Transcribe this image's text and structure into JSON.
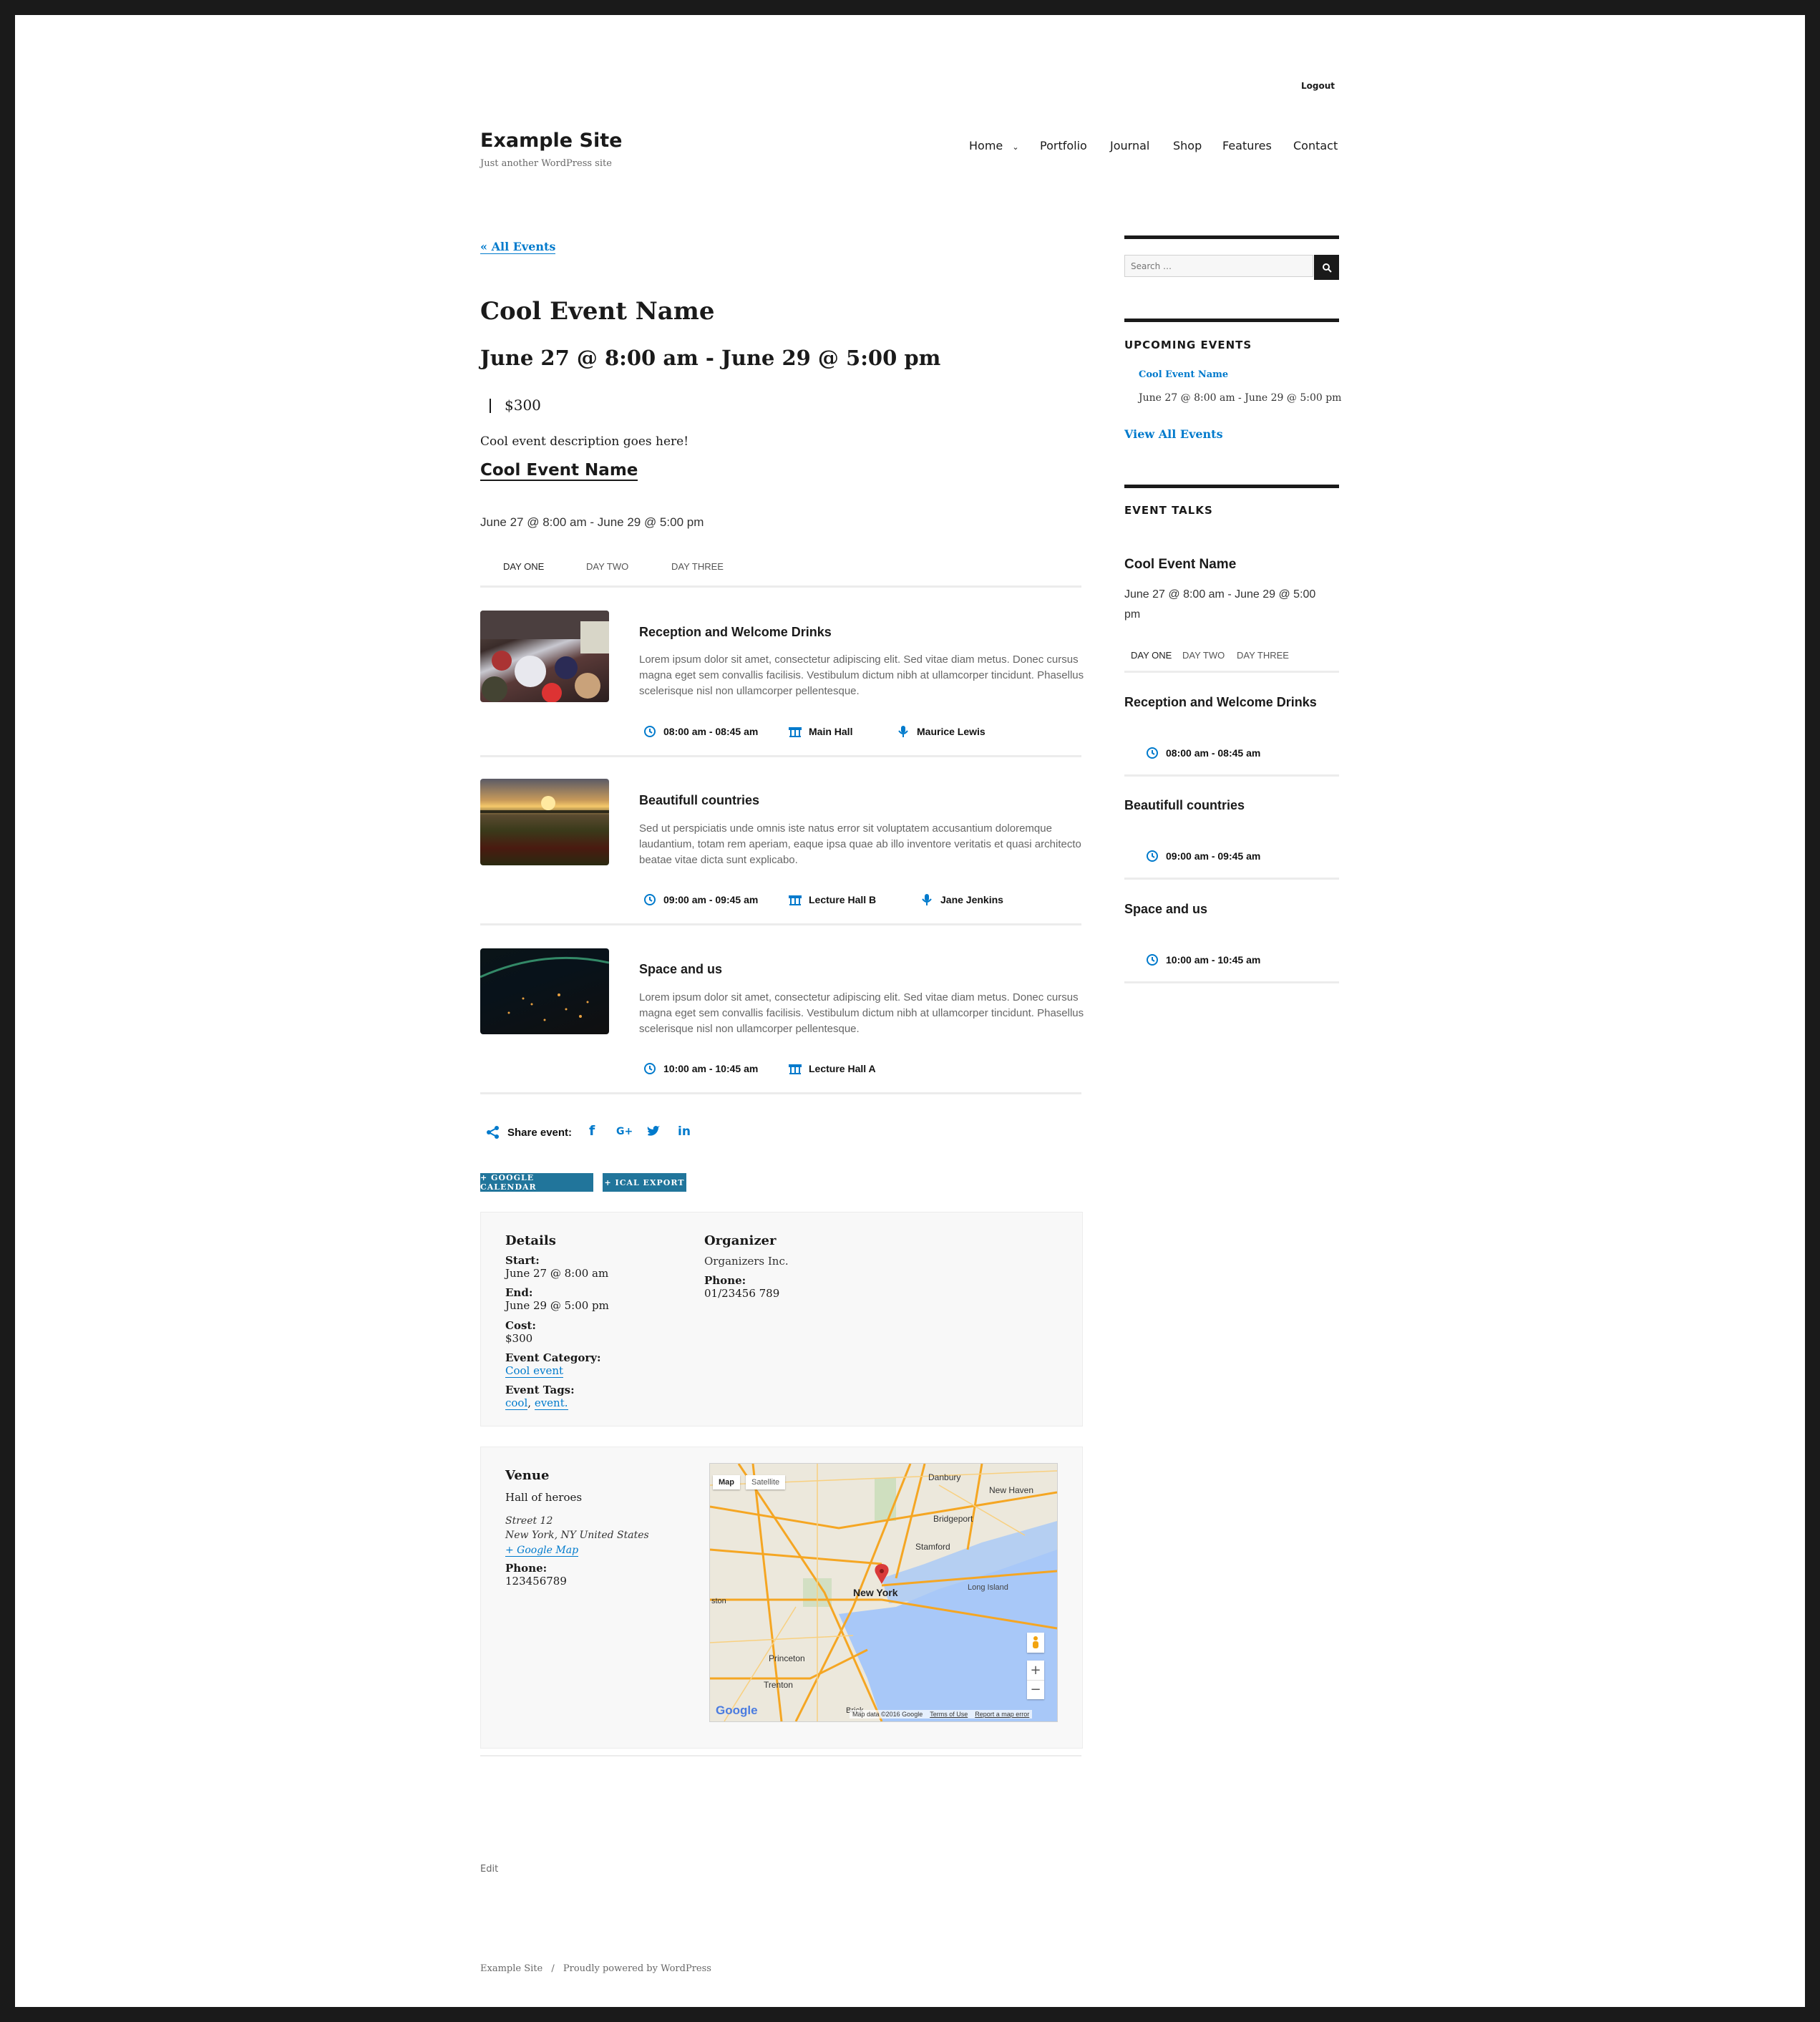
{
  "header": {
    "logout": "Logout",
    "site_title": "Example Site",
    "tagline": "Just another WordPress site",
    "nav": [
      "Home",
      "Portfolio",
      "Journal",
      "Shop",
      "Features",
      "Contact"
    ]
  },
  "main": {
    "back_link": "« All Events",
    "event_title": "Cool Event Name",
    "event_datetime": "June 27 @ 8:00 am - June 29 @ 5:00 pm",
    "cost": "$300",
    "description": "Cool event description goes here!",
    "talks_block": {
      "title": "Cool Event Name",
      "datetime": "June 27 @ 8:00 am - June 29 @ 5:00 pm",
      "tabs": [
        "DAY ONE",
        "DAY TWO",
        "DAY THREE"
      ],
      "talks": [
        {
          "title": "Reception and Welcome Drinks",
          "text": "Lorem ipsum dolor sit amet, consectetur adipiscing elit. Sed vitae diam metus. Donec cursus magna eget sem convallis facilisis. Vestibulum dictum nibh at ullamcorper tincidunt. Phasellus scelerisque nisl non ullamcorper pellentesque.",
          "time": "08:00 am - 08:45 am",
          "location": "Main Hall",
          "speaker": "Maurice Lewis"
        },
        {
          "title": "Beautifull countries",
          "text": "Sed ut perspiciatis unde omnis iste natus error sit voluptatem accusantium doloremque laudantium, totam rem aperiam, eaque ipsa quae ab illo inventore veritatis et quasi architecto beatae vitae dicta sunt explicabo.",
          "time": "09:00 am - 09:45 am",
          "location": "Lecture Hall B",
          "speaker": "Jane Jenkins"
        },
        {
          "title": "Space and us",
          "text": "Lorem ipsum dolor sit amet, consectetur adipiscing elit. Sed vitae diam metus. Donec cursus magna eget sem convallis facilisis. Vestibulum dictum nibh at ullamcorper tincidunt. Phasellus scelerisque nisl non ullamcorper pellentesque.",
          "time": "10:00 am - 10:45 am",
          "location": "Lecture Hall A",
          "speaker": ""
        }
      ]
    },
    "share_label": "Share event:",
    "buttons": {
      "google_calendar": "+ GOOGLE CALENDAR",
      "ical_export": "+ ICAL EXPORT"
    },
    "details": {
      "heading": "Details",
      "start_label": "Start:",
      "start_value": "June 27 @ 8:00 am",
      "end_label": "End:",
      "end_value": "June 29 @ 5:00 pm",
      "cost_label": "Cost:",
      "cost_value": "$300",
      "category_label": "Event Category:",
      "category_value": "Cool event",
      "tags_label": "Event Tags:",
      "tag1": "cool",
      "tag2": "event."
    },
    "organizer": {
      "heading": "Organizer",
      "name": "Organizers Inc.",
      "phone_label": "Phone:",
      "phone_value": "01/23456 789"
    },
    "venue": {
      "heading": "Venue",
      "name": "Hall of heroes",
      "street": "Street 12",
      "city": "New York, NY United States",
      "map_link": "+ Google Map",
      "phone_label": "Phone:",
      "phone_value": "123456789"
    },
    "map": {
      "tab_map": "Map",
      "tab_satellite": "Satellite",
      "labels": [
        "Danbury",
        "New Haven",
        "Bridgeport",
        "Stamford",
        "New York",
        "Long Island",
        "Princeton",
        "Trenton",
        "ston",
        "Brick"
      ],
      "footer_data": "Map data ©2016 Google",
      "footer_terms": "Terms of Use",
      "footer_report": "Report a map error",
      "logo": "Google"
    },
    "edit_link": "Edit"
  },
  "sidebar": {
    "search_placeholder": "Search …",
    "upcoming_heading": "UPCOMING EVENTS",
    "upcoming_event_title": "Cool Event Name",
    "upcoming_event_date": "June 27 @ 8:00 am - June 29 @ 5:00 pm",
    "view_all": "View All Events",
    "talks_heading": "EVENT TALKS",
    "talks_title": "Cool Event Name",
    "talks_date_line1": "June 27 @ 8:00 am - June 29 @ 5:00",
    "talks_date_line2": "pm",
    "tabs": [
      "DAY ONE",
      "DAY TWO",
      "DAY THREE"
    ],
    "talks": [
      {
        "title": "Reception and Welcome Drinks",
        "time": "08:00 am - 08:45 am"
      },
      {
        "title": "Beautifull countries",
        "time": "09:00 am - 09:45 am"
      },
      {
        "title": "Space and us",
        "time": "10:00 am - 10:45 am"
      }
    ]
  },
  "footer": {
    "site": "Example Site",
    "separator": "/",
    "powered": "Proudly powered by WordPress"
  }
}
